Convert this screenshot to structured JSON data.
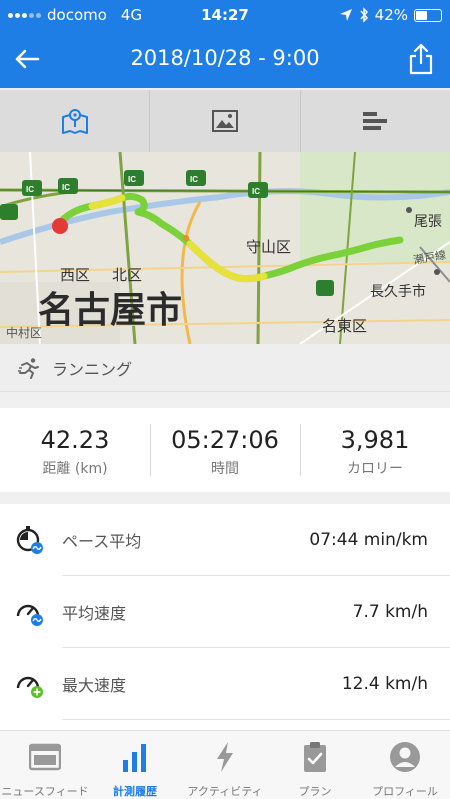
{
  "status_bar": {
    "carrier": "docomo",
    "network": "4G",
    "time": "14:27",
    "battery": "42%",
    "battery_level": 0.42
  },
  "header": {
    "title": "2018/10/28 - 9:00"
  },
  "tabs": [
    {
      "icon": "map-icon",
      "active": true
    },
    {
      "icon": "image-icon",
      "active": false
    },
    {
      "icon": "bars-icon",
      "active": false
    }
  ],
  "map": {
    "labels": {
      "city": "名古屋市",
      "ward_nishi": "西区",
      "ward_kita": "北区",
      "ward_moriyama": "守山区",
      "ward_meito": "名東区",
      "nagakute": "長久手市",
      "owari": "尾張",
      "seto_line": "瀬戸線",
      "nakamura": "中村区",
      "ic": "IC"
    }
  },
  "activity": {
    "type_label": "ランニング"
  },
  "summary": [
    {
      "value": "42.23",
      "label": "距離 (km)"
    },
    {
      "value": "05:27:06",
      "label": "時間"
    },
    {
      "value": "3,981",
      "label": "カロリー"
    }
  ],
  "details": [
    {
      "name": "ペース平均",
      "value": "07:44 min/km"
    },
    {
      "name": "平均速度",
      "value": "7.7 km/h"
    },
    {
      "name": "最大速度",
      "value": "12.4 km/h"
    }
  ],
  "bottom_nav": [
    {
      "label": "ニュースフィード",
      "active": false
    },
    {
      "label": "計測履歴",
      "active": true
    },
    {
      "label": "アクティビティ",
      "active": false
    },
    {
      "label": "プラン",
      "active": false
    },
    {
      "label": "プロフィール",
      "active": false
    }
  ],
  "colors": {
    "brand_blue": "#1f7ee6",
    "route_green": "#7bd13a",
    "route_yellow": "#e6e23a",
    "start_red": "#e53935"
  }
}
